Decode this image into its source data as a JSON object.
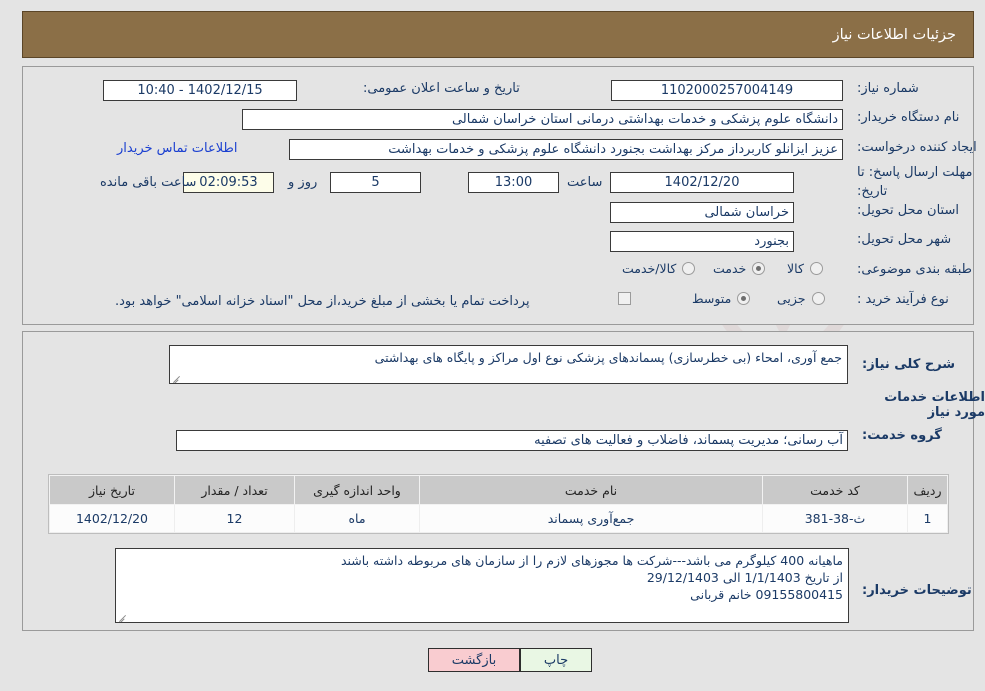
{
  "header": {
    "title": "جزئیات اطلاعات نیاز"
  },
  "fields": {
    "need_number_label": "شماره نیاز:",
    "need_number_value": "1102000257004149",
    "announce_label": "تاریخ و ساعت اعلان عمومی:",
    "announce_value": "1402/12/15 - 10:40",
    "buyer_org_label": "نام دستگاه خریدار:",
    "buyer_org_value": "دانشگاه علوم پزشکی و خدمات بهداشتی درمانی استان خراسان شمالی",
    "requester_label": "ایجاد کننده درخواست:",
    "requester_value": "عزیز ایزانلو کاربرداز مرکز بهداشت بجنورد دانشگاه علوم پزشکی و خدمات بهداشت",
    "contact_link": "اطلاعات تماس خریدار",
    "deadline_label_line1": "مهلت ارسال پاسخ: تا",
    "deadline_label_line2": "تاریخ:",
    "deadline_date": "1402/12/20",
    "deadline_hour_label": "ساعت",
    "deadline_hour": "13:00",
    "remaining_days": "5",
    "remaining_days_label": "روز و",
    "remaining_time": "02:09:53",
    "remaining_time_label": "ساعت باقی مانده",
    "province_label": "استان محل تحویل:",
    "province_value": "خراسان شمالی",
    "city_label": "شهر محل تحویل:",
    "city_value": "بجنورد",
    "category_label": "طبقه بندی موضوعی:",
    "process_label": "نوع فرآیند خرید :",
    "treasury_note": "پرداخت تمام یا بخشی از مبلغ خرید،از محل \"اسناد خزانه اسلامی\" خواهد بود."
  },
  "category_options": [
    {
      "label": "کالا",
      "selected": false
    },
    {
      "label": "خدمت",
      "selected": true
    },
    {
      "label": "کالا/خدمت",
      "selected": false
    }
  ],
  "process_options": [
    {
      "label": "جزیی",
      "selected": false
    },
    {
      "label": "متوسط",
      "selected": true
    }
  ],
  "description": {
    "summary_label": "شرح کلی نیاز:",
    "summary_value": "جمع آوری، امحاء (بی خطرسازی) پسماندهای پزشکی نوع اول مراکز و پایگاه های بهداشتی",
    "services_header": "اطلاعات خدمات مورد نیاز",
    "service_group_label": "گروه خدمت:",
    "service_group_value": "آب رسانی؛ مدیریت پسماند، فاضلاب و فعالیت های تصفیه"
  },
  "table": {
    "headers": [
      "ردیف",
      "کد خدمت",
      "نام خدمت",
      "واحد اندازه گیری",
      "تعداد / مقدار",
      "تاریخ نیاز"
    ],
    "rows": [
      {
        "row_no": "1",
        "service_code": "ث-38-381",
        "service_name": "جمع‌آوری پسماند",
        "unit": "ماه",
        "quantity": "12",
        "need_date": "1402/12/20"
      }
    ]
  },
  "buyer_notes": {
    "label": "توضیحات خریدار:",
    "line1": "ماهیانه 400 کیلوگرم  می باشد---شرکت ها مجوزهای لازم را از سازمان های مربوطه داشته باشند",
    "line2": "از تاریخ 1/1/1403 الی 29/12/1403",
    "line3": "09155800415 خانم قربانی"
  },
  "buttons": {
    "back": "بازگشت",
    "print": "چاپ"
  },
  "watermark": {
    "text": "AnaTender.net"
  },
  "colors": {
    "header_bg": "#8b6f47",
    "page_bg": "#e4e4e4",
    "label_text": "#1b3a66",
    "link": "#1a3fd0",
    "back_btn": "#f9ccd0",
    "print_btn": "#e9f7e4",
    "timer_bg": "#fdfde9"
  }
}
